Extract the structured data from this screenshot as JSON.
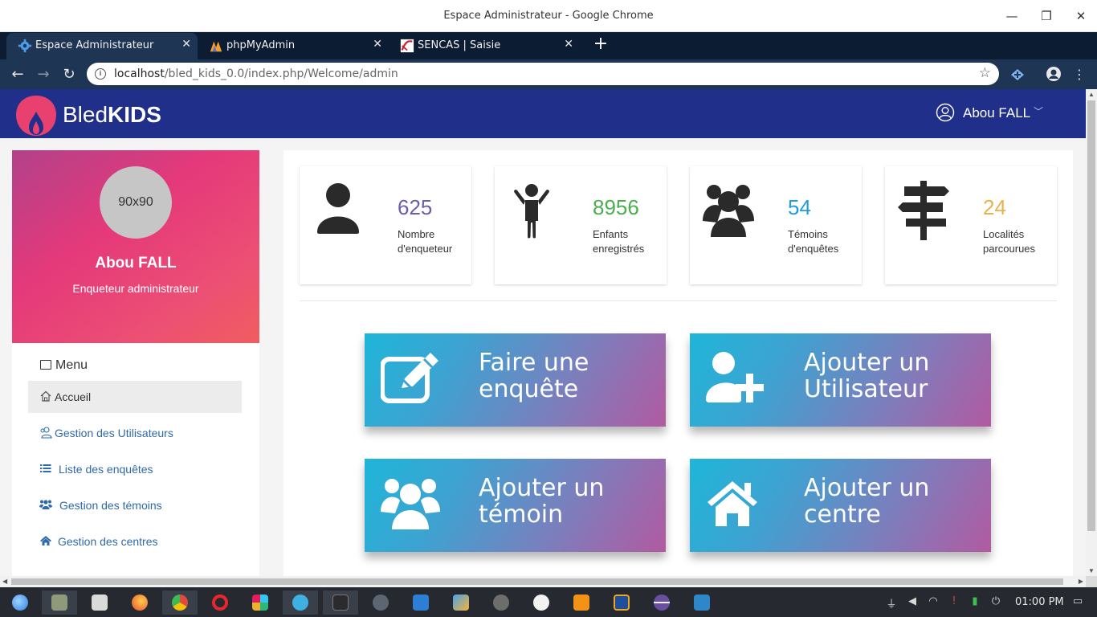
{
  "window": {
    "title": "Espace Administrateur - Google Chrome",
    "minimize": "—",
    "maximize": "❐",
    "close": "✕"
  },
  "tabs": [
    {
      "title": "Espace Administrateur",
      "icon": "gear-icon",
      "active": true
    },
    {
      "title": "phpMyAdmin",
      "icon": "phpmyadmin-icon",
      "active": false
    },
    {
      "title": "SENCAS | Saisie",
      "icon": "sencas-icon",
      "active": false
    }
  ],
  "tab_close": "✕",
  "new_tab": "+",
  "toolbar": {
    "back": "←",
    "forward": "→",
    "reload": "↻",
    "url_host": "localhost",
    "url_path": "/bled_kids_0.0/index.php/Welcome/admin",
    "bookmark": "☆",
    "menu": "⋮"
  },
  "app": {
    "brand_light": "Bled",
    "brand_bold": "KIDS",
    "brand_color": "#e8416f",
    "header_color": "#1f2f8a",
    "user_name": "Abou FALL",
    "user_chevron": "﹀"
  },
  "profile": {
    "avatar_text": "90x90",
    "name": "Abou FALL",
    "role": "Enqueteur administrateur"
  },
  "menu": {
    "heading": "Menu",
    "items": [
      {
        "label": "Accueil",
        "icon": "home-icon",
        "active": true
      },
      {
        "label": "Gestion des Utilisateurs",
        "icon": "users-outline-icon",
        "active": false
      },
      {
        "label": "Liste des enquêtes",
        "icon": "list-icon",
        "active": false
      },
      {
        "label": "Gestion des témoins",
        "icon": "group-icon",
        "active": false
      },
      {
        "label": "Gestion des centres",
        "icon": "house-icon",
        "active": false
      }
    ]
  },
  "stats": [
    {
      "value": "625",
      "label": "Nombre d'enqueteur",
      "color": "#6a5fa8",
      "icon": "user-icon"
    },
    {
      "value": "8956",
      "label": "Enfants enregistrés",
      "color": "#4bae4f",
      "icon": "child-icon"
    },
    {
      "value": "54",
      "label": "Témoins d'enquêtes",
      "color": "#1e9de0",
      "icon": "group-icon"
    },
    {
      "value": "24",
      "label": "Localités parcourues",
      "color": "#e8b24a",
      "icon": "signpost-icon"
    }
  ],
  "actions": [
    {
      "label": "Faire une enquête",
      "icon": "edit-icon"
    },
    {
      "label": "Ajouter un Utilisateur",
      "icon": "user-plus-icon"
    },
    {
      "label": "Ajouter un témoin",
      "icon": "group-icon"
    },
    {
      "label": "Ajouter un centre",
      "icon": "house-icon"
    }
  ],
  "taskbar": {
    "clock": "01:00 PM",
    "apps": [
      "debian-icon",
      "files-icon",
      "store-icon",
      "firefox-icon",
      "chrome-icon",
      "opera-icon",
      "slack-icon",
      "mail-icon",
      "terminal-icon",
      "atom-icon",
      "vscode-icon",
      "feather-icon",
      "palette-icon",
      "emoji-icon",
      "sublime-icon",
      "eclipse-icon",
      "orb-icon",
      "screen-icon"
    ]
  }
}
